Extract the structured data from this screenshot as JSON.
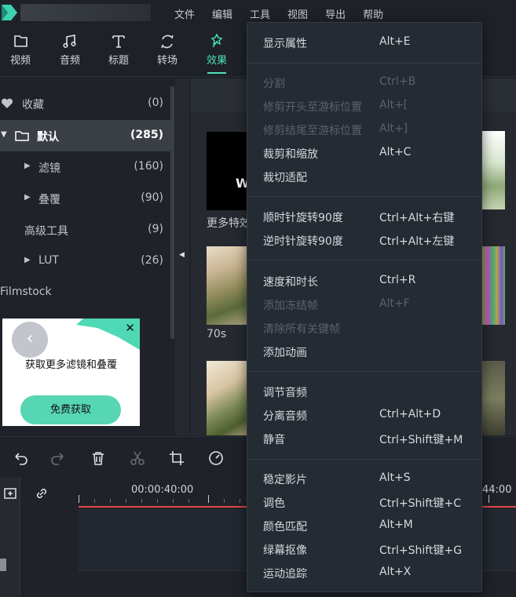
{
  "menubar": [
    "文件",
    "编辑",
    "工具",
    "视图",
    "导出",
    "帮助"
  ],
  "media_tabs": [
    {
      "label": "视频",
      "icon": "folder-icon"
    },
    {
      "label": "音频",
      "icon": "music-note-icon"
    },
    {
      "label": "标题",
      "icon": "title-t-icon"
    },
    {
      "label": "转场",
      "icon": "transition-icon"
    },
    {
      "label": "效果",
      "icon": "effects-sparkle-icon",
      "active": true
    }
  ],
  "sidebar": {
    "items": [
      {
        "label": "收藏",
        "count": "(0)",
        "icon": "heart-icon"
      },
      {
        "label": "默认",
        "count": "(285)",
        "icon": "folder-icon",
        "selected": true,
        "expanded": true
      },
      {
        "label": "滤镜",
        "count": "(160)",
        "icon": "caret-right-icon"
      },
      {
        "label": "叠覆",
        "count": "(90)",
        "icon": "caret-right-icon"
      },
      {
        "label": "高级工具",
        "count": "(9)"
      },
      {
        "label": "LUT",
        "count": "(26)",
        "icon": "caret-right-icon"
      }
    ],
    "section": "Filmstock",
    "promo": {
      "title": "获取更多滤镜和叠覆",
      "button": "免费获取"
    }
  },
  "library": {
    "items": [
      {
        "label": "更多特效"
      },
      {
        "label": "70s"
      }
    ],
    "overlay_text": "W"
  },
  "timeline": {
    "timecode": "00:00:40:00",
    "timecode_right": "44:00"
  },
  "tools_menu": {
    "groups": [
      [
        {
          "label": "显示属性",
          "shortcut": "Alt+E",
          "enabled": true
        }
      ],
      [
        {
          "label": "分割",
          "shortcut": "Ctrl+B",
          "enabled": false
        },
        {
          "label": "修剪开头至游标位置",
          "shortcut": "Alt+[",
          "enabled": false
        },
        {
          "label": "修剪结尾至游标位置",
          "shortcut": "Alt+]",
          "enabled": false
        },
        {
          "label": "裁剪和缩放",
          "shortcut": "Alt+C",
          "enabled": true
        },
        {
          "label": "裁切适配",
          "shortcut": "",
          "enabled": true
        }
      ],
      [
        {
          "label": "顺时针旋转90度",
          "shortcut": "Ctrl+Alt+右键",
          "enabled": true
        },
        {
          "label": "逆时针旋转90度",
          "shortcut": "Ctrl+Alt+左键",
          "enabled": true
        }
      ],
      [
        {
          "label": "速度和时长",
          "shortcut": "Ctrl+R",
          "enabled": true
        },
        {
          "label": "添加冻结帧",
          "shortcut": "Alt+F",
          "enabled": false
        },
        {
          "label": "清除所有关键帧",
          "shortcut": "",
          "enabled": false
        },
        {
          "label": "添加动画",
          "shortcut": "",
          "enabled": true
        }
      ],
      [
        {
          "label": "调节音频",
          "shortcut": "",
          "enabled": true
        },
        {
          "label": "分离音频",
          "shortcut": "Ctrl+Alt+D",
          "enabled": true
        },
        {
          "label": "静音",
          "shortcut": "Ctrl+Shift键+M",
          "enabled": true
        }
      ],
      [
        {
          "label": "稳定影片",
          "shortcut": "Alt+S",
          "enabled": true
        },
        {
          "label": "调色",
          "shortcut": "Ctrl+Shift键+C",
          "enabled": true
        },
        {
          "label": "颜色匹配",
          "shortcut": "Alt+M",
          "enabled": true
        },
        {
          "label": "绿幕抠像",
          "shortcut": "Ctrl+Shift键+G",
          "enabled": true
        },
        {
          "label": "运动追踪",
          "shortcut": "Alt+X",
          "enabled": true
        }
      ]
    ]
  },
  "colors": {
    "accent": "#4de0b8",
    "playhead": "#e0484a",
    "menu_bg": "#252b33"
  }
}
